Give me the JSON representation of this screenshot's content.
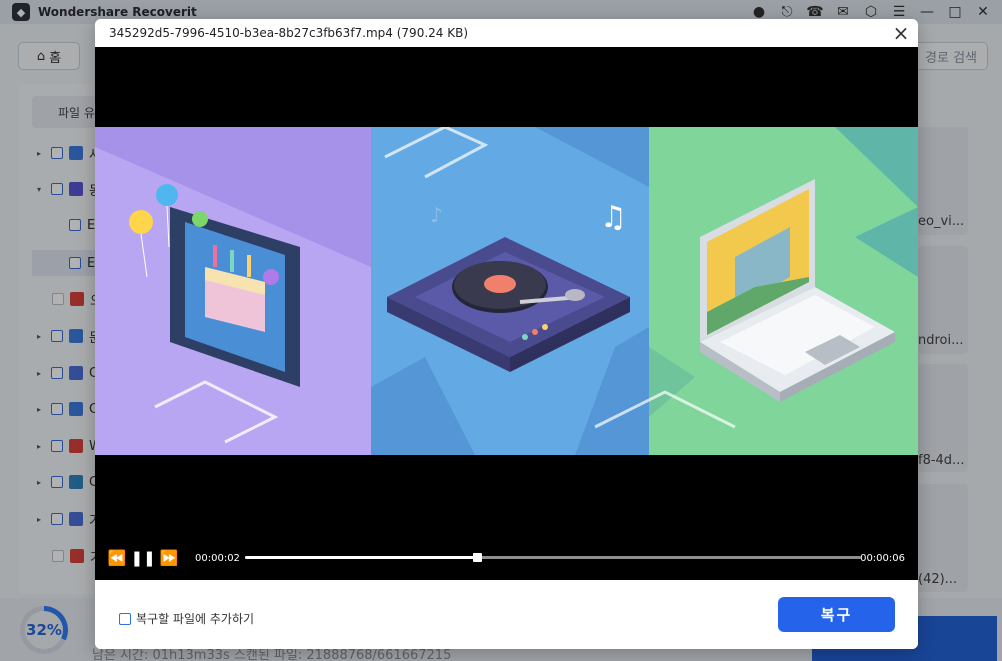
{
  "app": {
    "title": "Wondershare Recoverit",
    "window_icons": [
      "account-icon",
      "export-icon",
      "support-icon",
      "mail-icon",
      "box-icon",
      "menu-icon",
      "minimize-icon",
      "maximize-icon",
      "close-icon"
    ]
  },
  "toolbar": {
    "home_label": "홈",
    "path_search_label": "경로 검색"
  },
  "sidebar": {
    "header": "파일 유",
    "items": [
      {
        "label": "사",
        "icon_color": "#3f7be0"
      },
      {
        "label": "동",
        "icon_color": "#5a55d6"
      },
      {
        "label": "E",
        "icon_color": "#3f7be0"
      },
      {
        "label": "E",
        "icon_color": "#3f7be0"
      },
      {
        "label": "오",
        "icon_color": "#d9433b"
      },
      {
        "label": "문",
        "icon_color": "#3f7be0"
      },
      {
        "label": "O",
        "icon_color": "#4a6fd8"
      },
      {
        "label": "O",
        "icon_color": "#3f7be0"
      },
      {
        "label": "W",
        "icon_color": "#d9433b"
      },
      {
        "label": "O",
        "icon_color": "#2e86c1"
      },
      {
        "label": "기",
        "icon_color": "#4a6fd8"
      },
      {
        "label": "기",
        "icon_color": "#d9433b"
      }
    ]
  },
  "cards": [
    "eo_vi...",
    "ndroi...",
    "f8-4d...",
    "(42)..."
  ],
  "scan": {
    "progress_label": "32%",
    "progress_percent": 32,
    "status": "남은 시간: 01h13m33s  스캔된 파일: 21888768/661667215"
  },
  "preview": {
    "file_title": "345292d5-7996-4510-b3ea-8b27c3fb63f7.mp4 (790.24 KB)",
    "current_time": "00:00:02",
    "total_time": "00:00:06",
    "progress_fraction": 0.377,
    "add_to_recovery_label": "복구할 파일에 추가하기",
    "recover_label": "복구"
  },
  "colors": {
    "accent": "#2563eb",
    "panel_purple": "#b6a4f0",
    "panel_blue": "#62a9e3",
    "panel_green": "#7fd49a"
  }
}
